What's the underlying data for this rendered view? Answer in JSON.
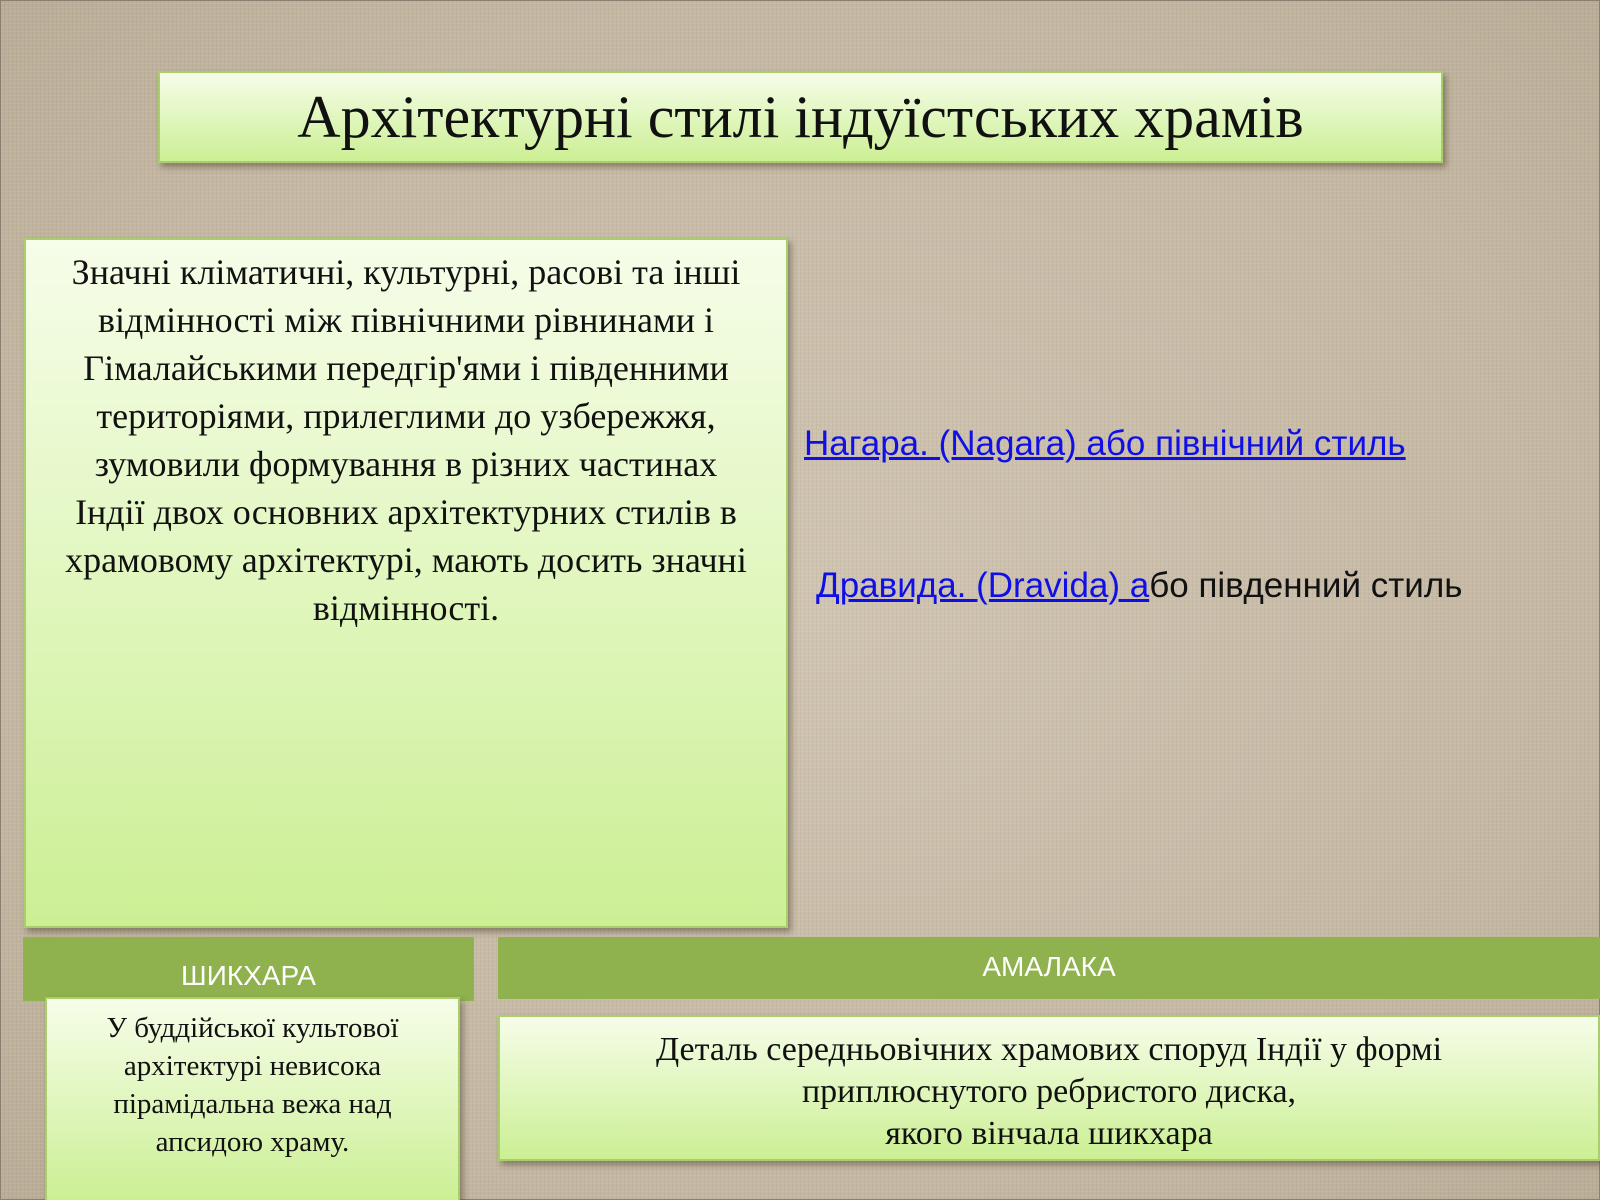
{
  "title": "Архітектурні стилі індуїстських храмів",
  "intro": {
    "text": "Значні кліматичні, культурні, расові та інші відмінності між північними рівнинами і Гімалайськими передгір'ями і південними територіями, прилеглими до узбережжя, зумовили формування в різних частинах Індії двох основних архітектурних стилів в храмовому архітектурі, мають досить значні відмінності."
  },
  "links": {
    "nagara": "Нагара. (Nagara) або північний стиль",
    "dravida_link": "Дравида. (Dravida) а",
    "dravida_rest": "бо південний стиль"
  },
  "shikhara": {
    "header": "ШИКХАРА",
    "text": "У буддійської культової архітектурі невисока пірамідальна вежа над апсидою храму."
  },
  "amalaka": {
    "header": "АМАЛАКА",
    "lines": [
      "Деталь середньовічних храмових споруд Індії у формі",
      "приплюснутого ребристого диска,",
      "якого вінчала шикхара"
    ]
  },
  "colors": {
    "header_green": "#8fb14e",
    "link_blue": "#1010e6",
    "box_green_light": "#f6fde9",
    "box_green_dark": "#ccef94"
  }
}
